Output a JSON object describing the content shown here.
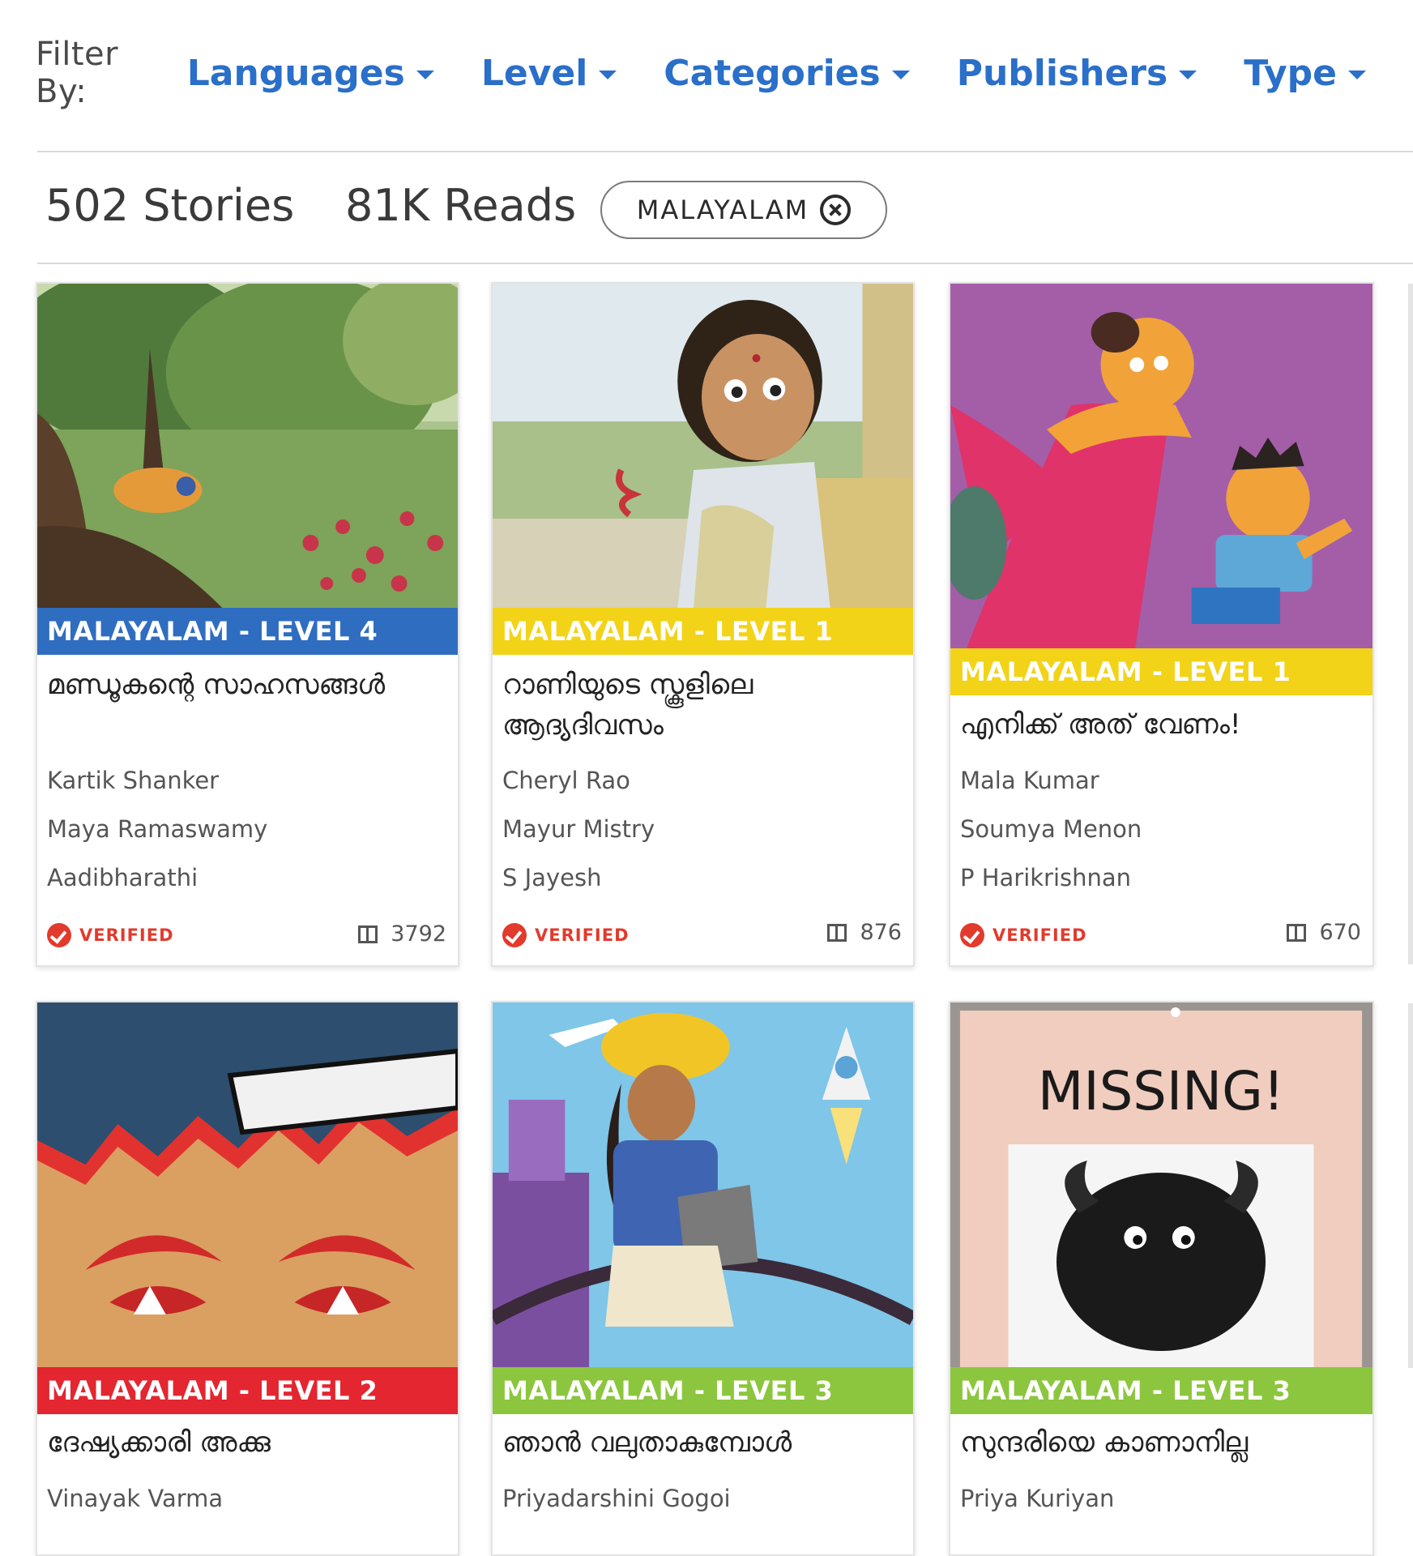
{
  "filters": {
    "label": "Filter By:",
    "items": [
      "Languages",
      "Level",
      "Categories",
      "Publishers",
      "Type"
    ]
  },
  "stats": {
    "stories": "502 Stories",
    "reads": "81K Reads",
    "active_filter": "MALAYALAM"
  },
  "colors": {
    "link_blue": "#2a6fc9",
    "level_1": "#f2d318",
    "level_2": "#e32630",
    "level_3": "#8cc63e",
    "level_4": "#2f6dc1",
    "verified_red": "#e23a2c"
  },
  "cards": [
    {
      "level": "MALAYALAM - LEVEL 4",
      "title": "മണ്ഡൂകന്റെ സാഹസങ്ങൾ",
      "author": "Kartik Shanker",
      "illustrator": "Maya Ramaswamy",
      "translator": "Aadibharathi",
      "verified": "VERIFIED",
      "reads": "3792"
    },
    {
      "level": "MALAYALAM - LEVEL 1",
      "title": "റാണിയുടെ സ്കൂളിലെ ആദ്യദിവസം",
      "author": "Cheryl Rao",
      "illustrator": "Mayur Mistry",
      "translator": "S Jayesh",
      "verified": "VERIFIED",
      "reads": "876"
    },
    {
      "level": "MALAYALAM - LEVEL 1",
      "title": "എനിക്ക് അത് വേണം!",
      "author": "Mala Kumar",
      "illustrator": "Soumya Menon",
      "translator": "P Harikrishnan",
      "verified": "VERIFIED",
      "reads": "670"
    },
    {
      "level": "MALAYALAM - LEVEL 2",
      "title": "ദേഷ്യക്കാരി അക്കു",
      "author": "Vinayak Varma"
    },
    {
      "level": "MALAYALAM - LEVEL 3",
      "title": "ഞാൻ വലുതാകുമ്പോൾ",
      "author": "Priyadarshini Gogoi"
    },
    {
      "level": "MALAYALAM - LEVEL 3",
      "title": "സുന്ദരിയെ കാണാനില്ല",
      "author": "Priya Kuriyan",
      "cover_text": "MISSING!"
    }
  ]
}
